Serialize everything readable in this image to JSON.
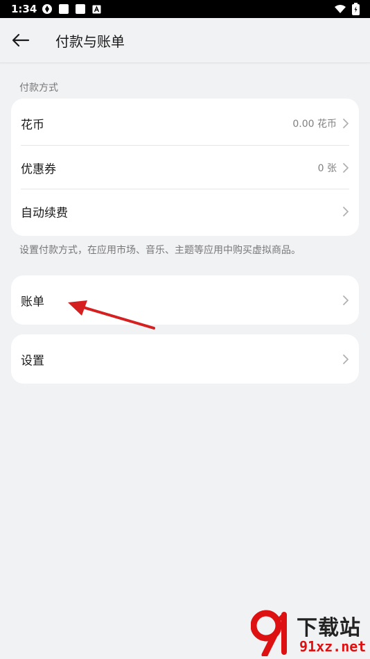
{
  "status_bar": {
    "time": "1:34"
  },
  "header": {
    "title": "付款与账单"
  },
  "payment": {
    "section_title": "付款方式",
    "items": [
      {
        "label": "花币",
        "value": "0.00 花币"
      },
      {
        "label": "优惠券",
        "value": "0 张"
      },
      {
        "label": "自动续费",
        "value": ""
      }
    ],
    "hint": "设置付款方式，在应用市场、音乐、主题等应用中购买虚拟商品。"
  },
  "bills": {
    "label": "账单"
  },
  "settings": {
    "label": "设置"
  },
  "watermark": {
    "title": "下载站",
    "domain": "91xz.net"
  },
  "colors": {
    "arrow": "#d42020",
    "background": "#f1f2f4",
    "card": "#ffffff"
  }
}
